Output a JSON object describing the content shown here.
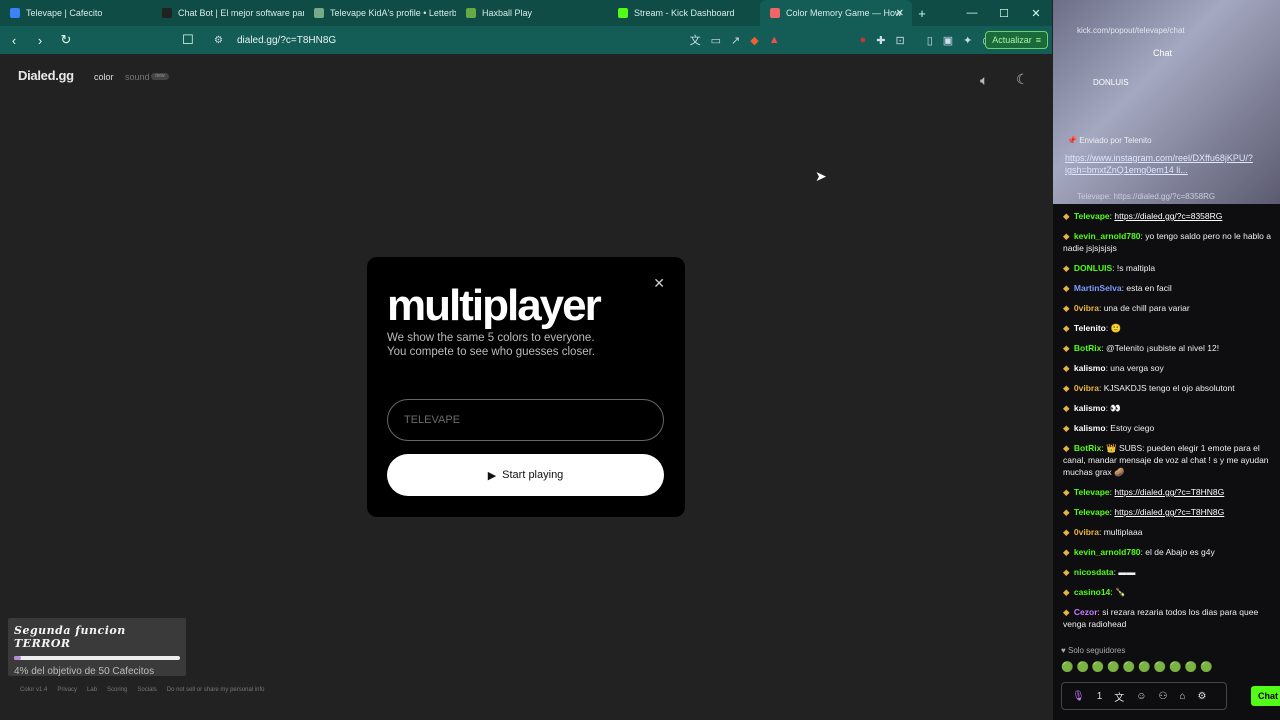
{
  "tabs": [
    {
      "label": "Televape | Cafecito",
      "color": "#3b82f6"
    },
    {
      "label": "Chat Bot | El mejor software para",
      "color": "#222"
    },
    {
      "label": "Televape KidA's profile • Letterbo",
      "color": "#7a8"
    },
    {
      "label": "Haxball Play",
      "color": "#6a4"
    },
    {
      "label": "Stream - Kick Dashboard",
      "color": "#53fc18"
    },
    {
      "label": "Color Memory Game — How",
      "color": "#e66"
    }
  ],
  "window_controls": {
    "minimize": "—",
    "maximize": "☐",
    "close": "✕"
  },
  "address": {
    "url": "dialed.gg/?c=T8HN8G",
    "update_label": "Actualizar"
  },
  "app": {
    "brand": "Dialed.gg",
    "mode_color": "color",
    "mode_sound": "sound",
    "mode_sound_badge": "new"
  },
  "modal": {
    "title": "multiplayer",
    "subtitle_1": "We show the same 5 colors to everyone.",
    "subtitle_2": "You compete to see who guesses closer.",
    "name_placeholder": "TELEVAPE",
    "start_label": "Start playing"
  },
  "goal": {
    "title": "Segunda funcion TERROR",
    "progress_pct": 4,
    "text": "4% del objetivo de 50 Cafecitos"
  },
  "footer": [
    "Color v1.4",
    "Privacy",
    "Lab",
    "Scoring",
    "Socials",
    "Do not sell or share my personal info"
  ],
  "chat": {
    "popout_url": "kick.com/popout/televape/chat",
    "label": "Chat",
    "top_user": "DONLUIS",
    "pinned_by": "Enviado por",
    "pinned_user": "Telenito",
    "pinned_link": "https://www.instagram.com/reel/DXffu68jKPU/?igsh=bmxtZnQ1emg0em14 li...",
    "prev_line": "Televape: https://dialed.gg/?c=8358RG",
    "messages": [
      {
        "user": "Televape",
        "color": "#53fc18",
        "text": "https://dialed.gg/?c=8358RG",
        "link": true
      },
      {
        "user": "kevin_arnold780",
        "color": "#53fc18",
        "text": "yo tengo saldo pero no le hablo a nadie jsjsjsjsjs"
      },
      {
        "user": "DONLUIS",
        "color": "#53fc18",
        "text": "!s maltipla"
      },
      {
        "user": "MartinSelva",
        "color": "#7c9cff",
        "text": "esta en facil"
      },
      {
        "user": "0vibra",
        "color": "#e6b43c",
        "text": "una de chill para variar"
      },
      {
        "user": "Telenito",
        "color": "#ffffff",
        "text": "🙂"
      },
      {
        "user": "BotRix",
        "color": "#53fc18",
        "text": "@Telenito ¡subiste al nivel 12!"
      },
      {
        "user": "kalismo",
        "color": "#ffffff",
        "text": "una verga soy"
      },
      {
        "user": "0vibra",
        "color": "#e6b43c",
        "text": "KJSAKDJS tengo el ojo absolutont"
      },
      {
        "user": "kalismo",
        "color": "#ffffff",
        "text": "👀"
      },
      {
        "user": "kalismo",
        "color": "#ffffff",
        "text": "Estoy ciego"
      },
      {
        "user": "BotRix",
        "color": "#53fc18",
        "text": "👑 SUBS: pueden elegir 1 emote para el canal, mandar mensaje de voz al chat ! s y me ayudan muchas grax 🥔"
      },
      {
        "user": "Televape",
        "color": "#53fc18",
        "text": "https://dialed.gg/?c=T8HN8G",
        "link": true
      },
      {
        "user": "Televape",
        "color": "#53fc18",
        "text": "https://dialed.gg/?c=T8HN8G",
        "link": true
      },
      {
        "user": "0vibra",
        "color": "#e6b43c",
        "text": "multiplaaa"
      },
      {
        "user": "kevin_arnold780",
        "color": "#53fc18",
        "text": "el de Abajo es g4y"
      },
      {
        "user": "nicosdata",
        "color": "#53fc18",
        "text": "▬▬"
      },
      {
        "user": "casino14",
        "color": "#53fc18",
        "text": "🍾"
      },
      {
        "user": "Cezor",
        "color": "#c77dff",
        "text": "si rezara rezaria todos los dias para quee venga radiohead"
      }
    ],
    "followers_only": "Solo seguidores",
    "input_count": "1",
    "send_label": "Chat"
  }
}
